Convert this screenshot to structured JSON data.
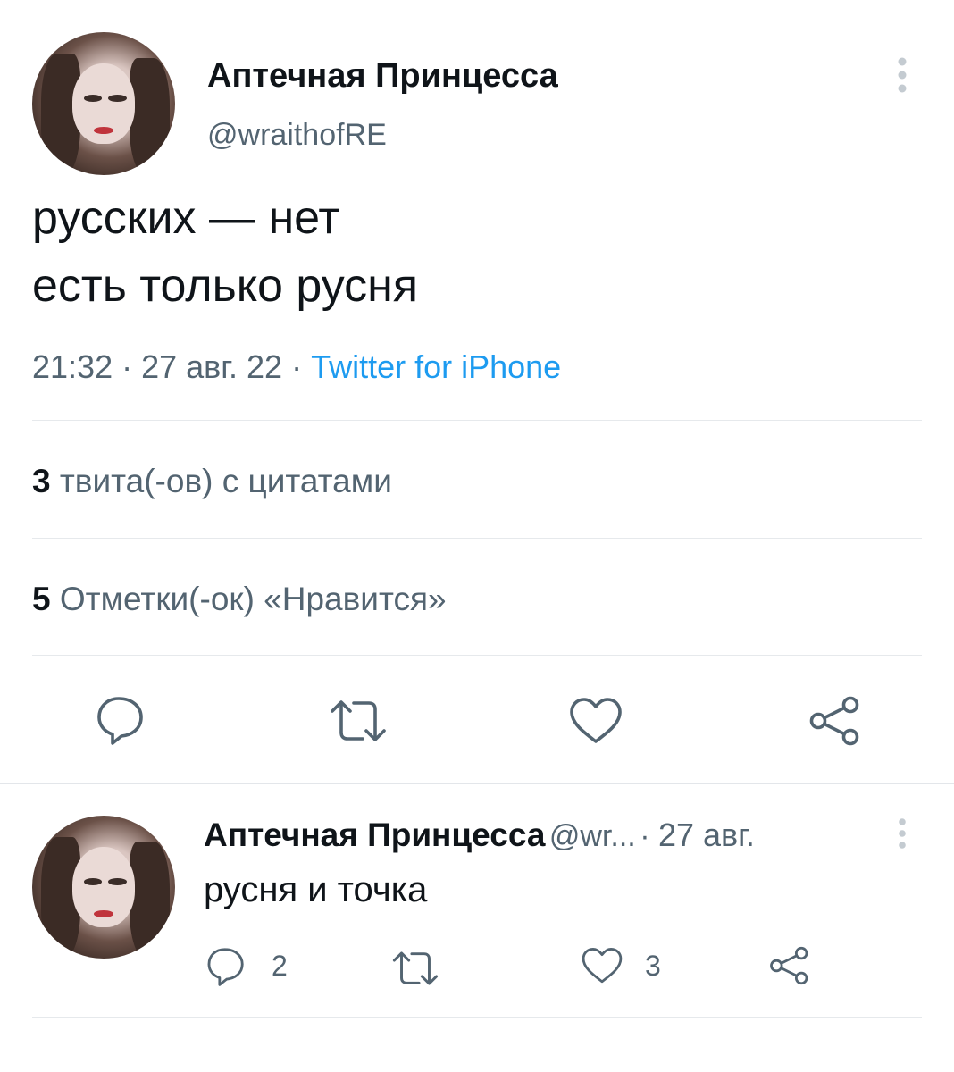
{
  "tweet": {
    "author_name": "Аптечная Принцесса",
    "author_handle": "@wraithofRE",
    "text_line1": "русских — нет",
    "text_line2": "есть только русня",
    "time": "21:32",
    "date": "27 авг. 22",
    "source": "Twitter for iPhone",
    "quote_count": "3",
    "quote_label": "твита(-ов) с цитатами",
    "like_count": "5",
    "like_label": "Отметки(-ок) «Нравится»"
  },
  "reply": {
    "author_name": "Аптечная Принцесса",
    "author_handle": "@wr...",
    "date": "27 авг.",
    "text": "русня и точка",
    "reply_count": "2",
    "like_count": "3"
  },
  "icons": {
    "more": "more-vertical-icon",
    "reply": "comment-icon",
    "retweet": "retweet-icon",
    "like": "heart-icon",
    "share": "share-icon"
  },
  "colors": {
    "text": "#0f1419",
    "secondary": "#536471",
    "link": "#1d9bf0",
    "divider": "#e6e9ec"
  }
}
